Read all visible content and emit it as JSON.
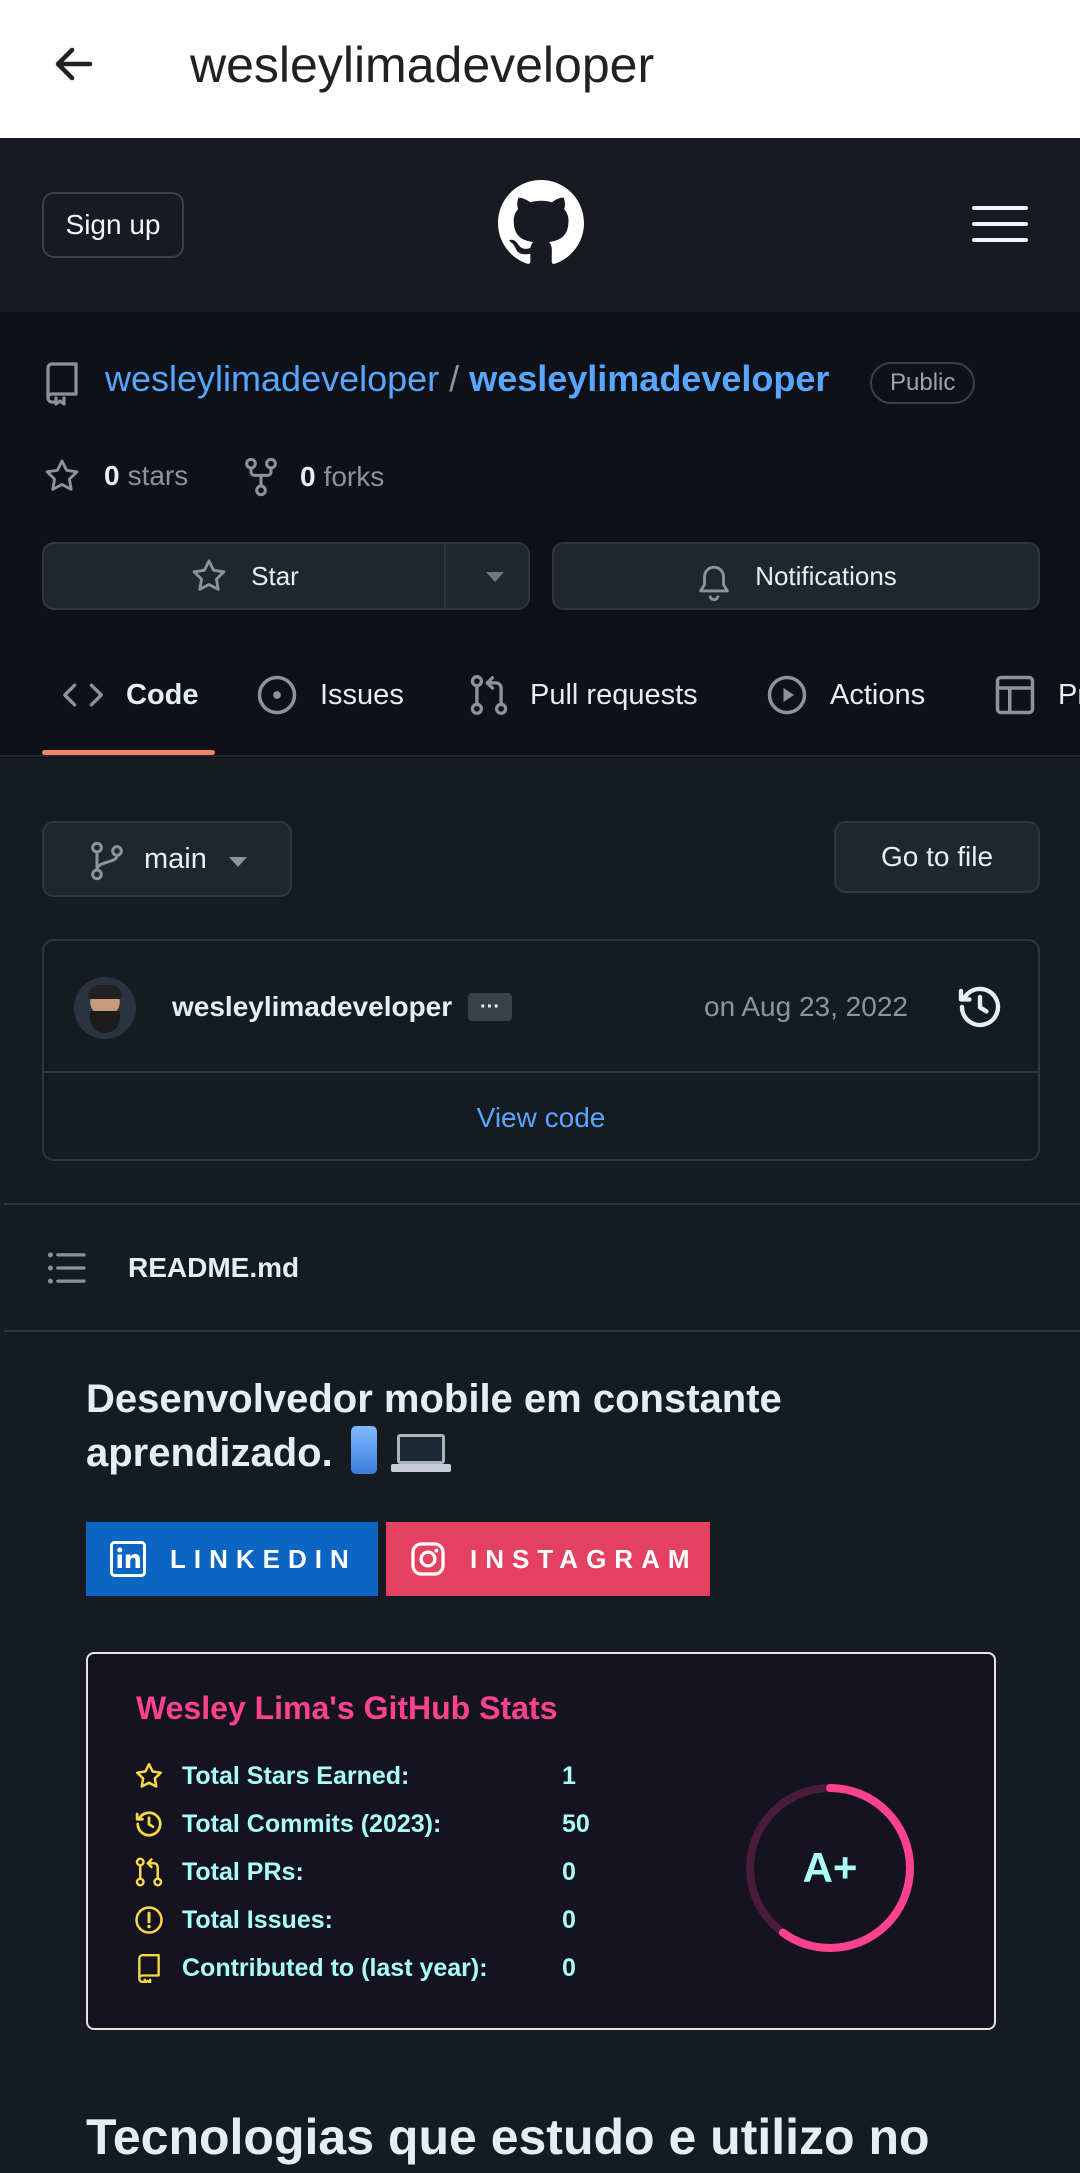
{
  "app_bar": {
    "title": "wesleylimadeveloper"
  },
  "header": {
    "signup_label": "Sign up"
  },
  "repo": {
    "owner": "wesleylimadeveloper",
    "separator": "/",
    "name": "wesleylimadeveloper",
    "visibility": "Public",
    "stars_count": "0",
    "stars_label": "stars",
    "forks_count": "0",
    "forks_label": "forks",
    "star_button": "Star",
    "notifications_button": "Notifications"
  },
  "tabs": [
    {
      "label": "Code",
      "icon": "code-icon",
      "active": true
    },
    {
      "label": "Issues",
      "icon": "issue-opened-icon"
    },
    {
      "label": "Pull requests",
      "icon": "git-pull-request-icon"
    },
    {
      "label": "Actions",
      "icon": "play-icon"
    },
    {
      "label": "Projects",
      "icon": "table-icon"
    }
  ],
  "branch": {
    "name": "main",
    "go_to_file": "Go to file"
  },
  "commit": {
    "author": "wesleylimadeveloper",
    "ellipsis": "···",
    "date": "on Aug 23, 2022",
    "view_code": "View code"
  },
  "readme": {
    "filename": "README.md",
    "intro": "Desenvolvedor mobile em constante aprendizado.",
    "linkedin_label": "LINKEDIN",
    "instagram_label": "INSTAGRAM",
    "heading2": "Tecnologias que estudo e utilizo no"
  },
  "stats_card": {
    "title": "Wesley Lima's GitHub Stats",
    "rows": [
      {
        "label": "Total Stars Earned:",
        "value": "1",
        "icon": "star-icon"
      },
      {
        "label": "Total Commits (2023):",
        "value": "50",
        "icon": "history-icon"
      },
      {
        "label": "Total PRs:",
        "value": "0",
        "icon": "pull-request-icon"
      },
      {
        "label": "Total Issues:",
        "value": "0",
        "icon": "issue-icon"
      },
      {
        "label": "Contributed to (last year):",
        "value": "0",
        "icon": "repo-icon"
      }
    ],
    "rank": "A+",
    "rank_progress": 0.6
  },
  "colors": {
    "accent_link": "#58a6ff",
    "tab_underline": "#f78166",
    "stats_title": "#fe428e",
    "stats_text": "#a9fef7",
    "stats_icon": "#f8d847",
    "linkedin": "#0a66c2",
    "instagram": "#e4405f"
  }
}
